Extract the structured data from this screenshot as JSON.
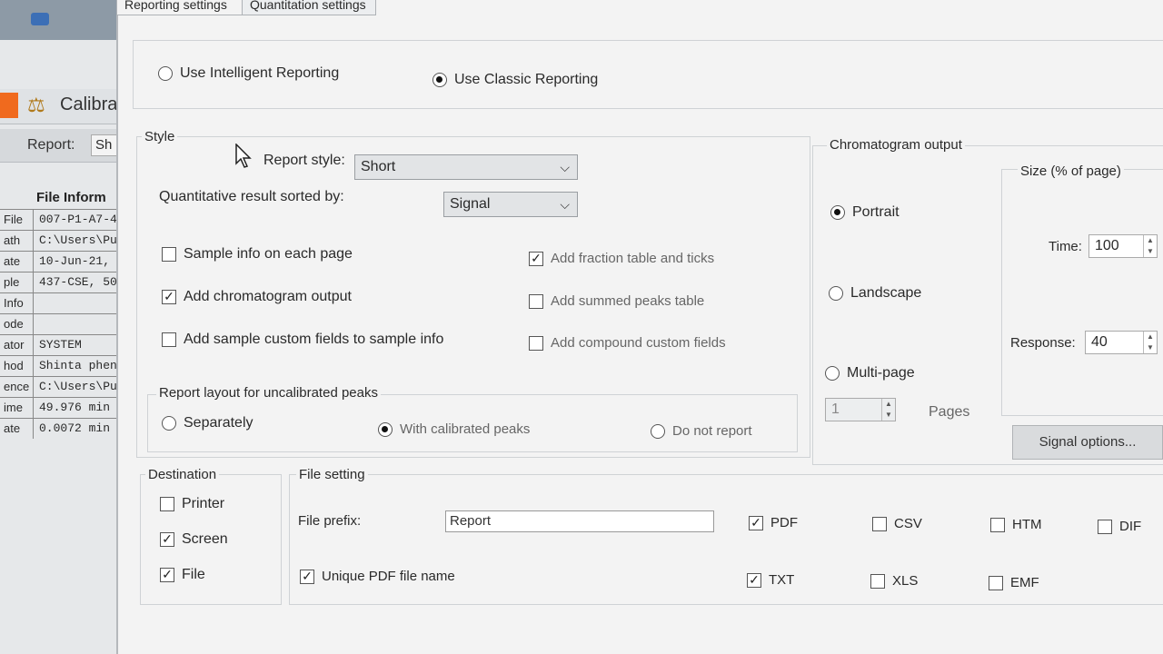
{
  "tabs": {
    "reporting": "Reporting settings",
    "quantitation": "Quantitation settings"
  },
  "background_app": {
    "calibration_label": "Calibra",
    "report_label": "Report:",
    "report_value": "Sh",
    "table_header": "File Inform",
    "rows": [
      {
        "k": "File",
        "v": "007-P1-A7-4"
      },
      {
        "k": "ath",
        "v": "C:\\Users\\Pu"
      },
      {
        "k": "ate",
        "v": "10-Jun-21,"
      },
      {
        "k": "ple",
        "v": "437-CSE, 50"
      },
      {
        "k": "Info",
        "v": ""
      },
      {
        "k": "ode",
        "v": ""
      },
      {
        "k": "ator",
        "v": "SYSTEM"
      },
      {
        "k": "hod",
        "v": "Shinta phen"
      },
      {
        "k": "ence",
        "v": "C:\\Users\\Pu"
      },
      {
        "k": "ime",
        "v": "49.976 min"
      },
      {
        "k": "ate",
        "v": "0.0072 min"
      }
    ]
  },
  "reporting_mode": {
    "intelligent": "Use Intelligent Reporting",
    "classic": "Use Classic Reporting",
    "selected": "classic"
  },
  "style": {
    "title": "Style",
    "report_style_label": "Report style:",
    "report_style_value": "Short",
    "sorted_by_label": "Quantitative result sorted by:",
    "sorted_by_value": "Signal",
    "checks": {
      "sample_info": {
        "label": "Sample info on each page",
        "checked": false
      },
      "add_chromatogram": {
        "label": "Add chromatogram output",
        "checked": true
      },
      "custom_fields_sample": {
        "label": "Add sample custom fields to sample info",
        "checked": false
      },
      "fraction_table": {
        "label": "Add fraction table and ticks",
        "checked": true
      },
      "summed_peaks": {
        "label": "Add summed peaks table",
        "checked": false
      },
      "compound_custom": {
        "label": "Add compound custom fields",
        "checked": false
      }
    },
    "uncalibrated": {
      "title": "Report layout for uncalibrated peaks",
      "separately": "Separately",
      "with_calibrated": "With calibrated peaks",
      "do_not_report": "Do not report",
      "selected": "with_calibrated"
    }
  },
  "chromatogram": {
    "title": "Chromatogram output",
    "portrait": "Portrait",
    "landscape": "Landscape",
    "multipage": "Multi-page",
    "selected": "portrait",
    "pages_value": "1",
    "pages_label": "Pages",
    "size_title": "Size (% of page)",
    "time_label": "Time:",
    "time_value": "100",
    "response_label": "Response:",
    "response_value": "40",
    "signal_options": "Signal options..."
  },
  "destination": {
    "title": "Destination",
    "printer": {
      "label": "Printer",
      "checked": false
    },
    "screen": {
      "label": "Screen",
      "checked": true
    },
    "file": {
      "label": "File",
      "checked": true
    }
  },
  "file_setting": {
    "title": "File setting",
    "prefix_label": "File prefix:",
    "prefix_value": "Report",
    "unique_pdf": {
      "label": "Unique PDF file name",
      "checked": true
    },
    "formats": {
      "pdf": {
        "label": "PDF",
        "checked": true
      },
      "csv": {
        "label": "CSV",
        "checked": false
      },
      "htm": {
        "label": "HTM",
        "checked": false
      },
      "dif": {
        "label": "DIF",
        "checked": false
      },
      "txt": {
        "label": "TXT",
        "checked": true
      },
      "xls": {
        "label": "XLS",
        "checked": false
      },
      "emf": {
        "label": "EMF",
        "checked": false
      }
    }
  },
  "icons": {
    "cursor": "arrow-cursor-icon",
    "calibration": "scale-icon",
    "dropdown": "chevron-down-icon"
  }
}
